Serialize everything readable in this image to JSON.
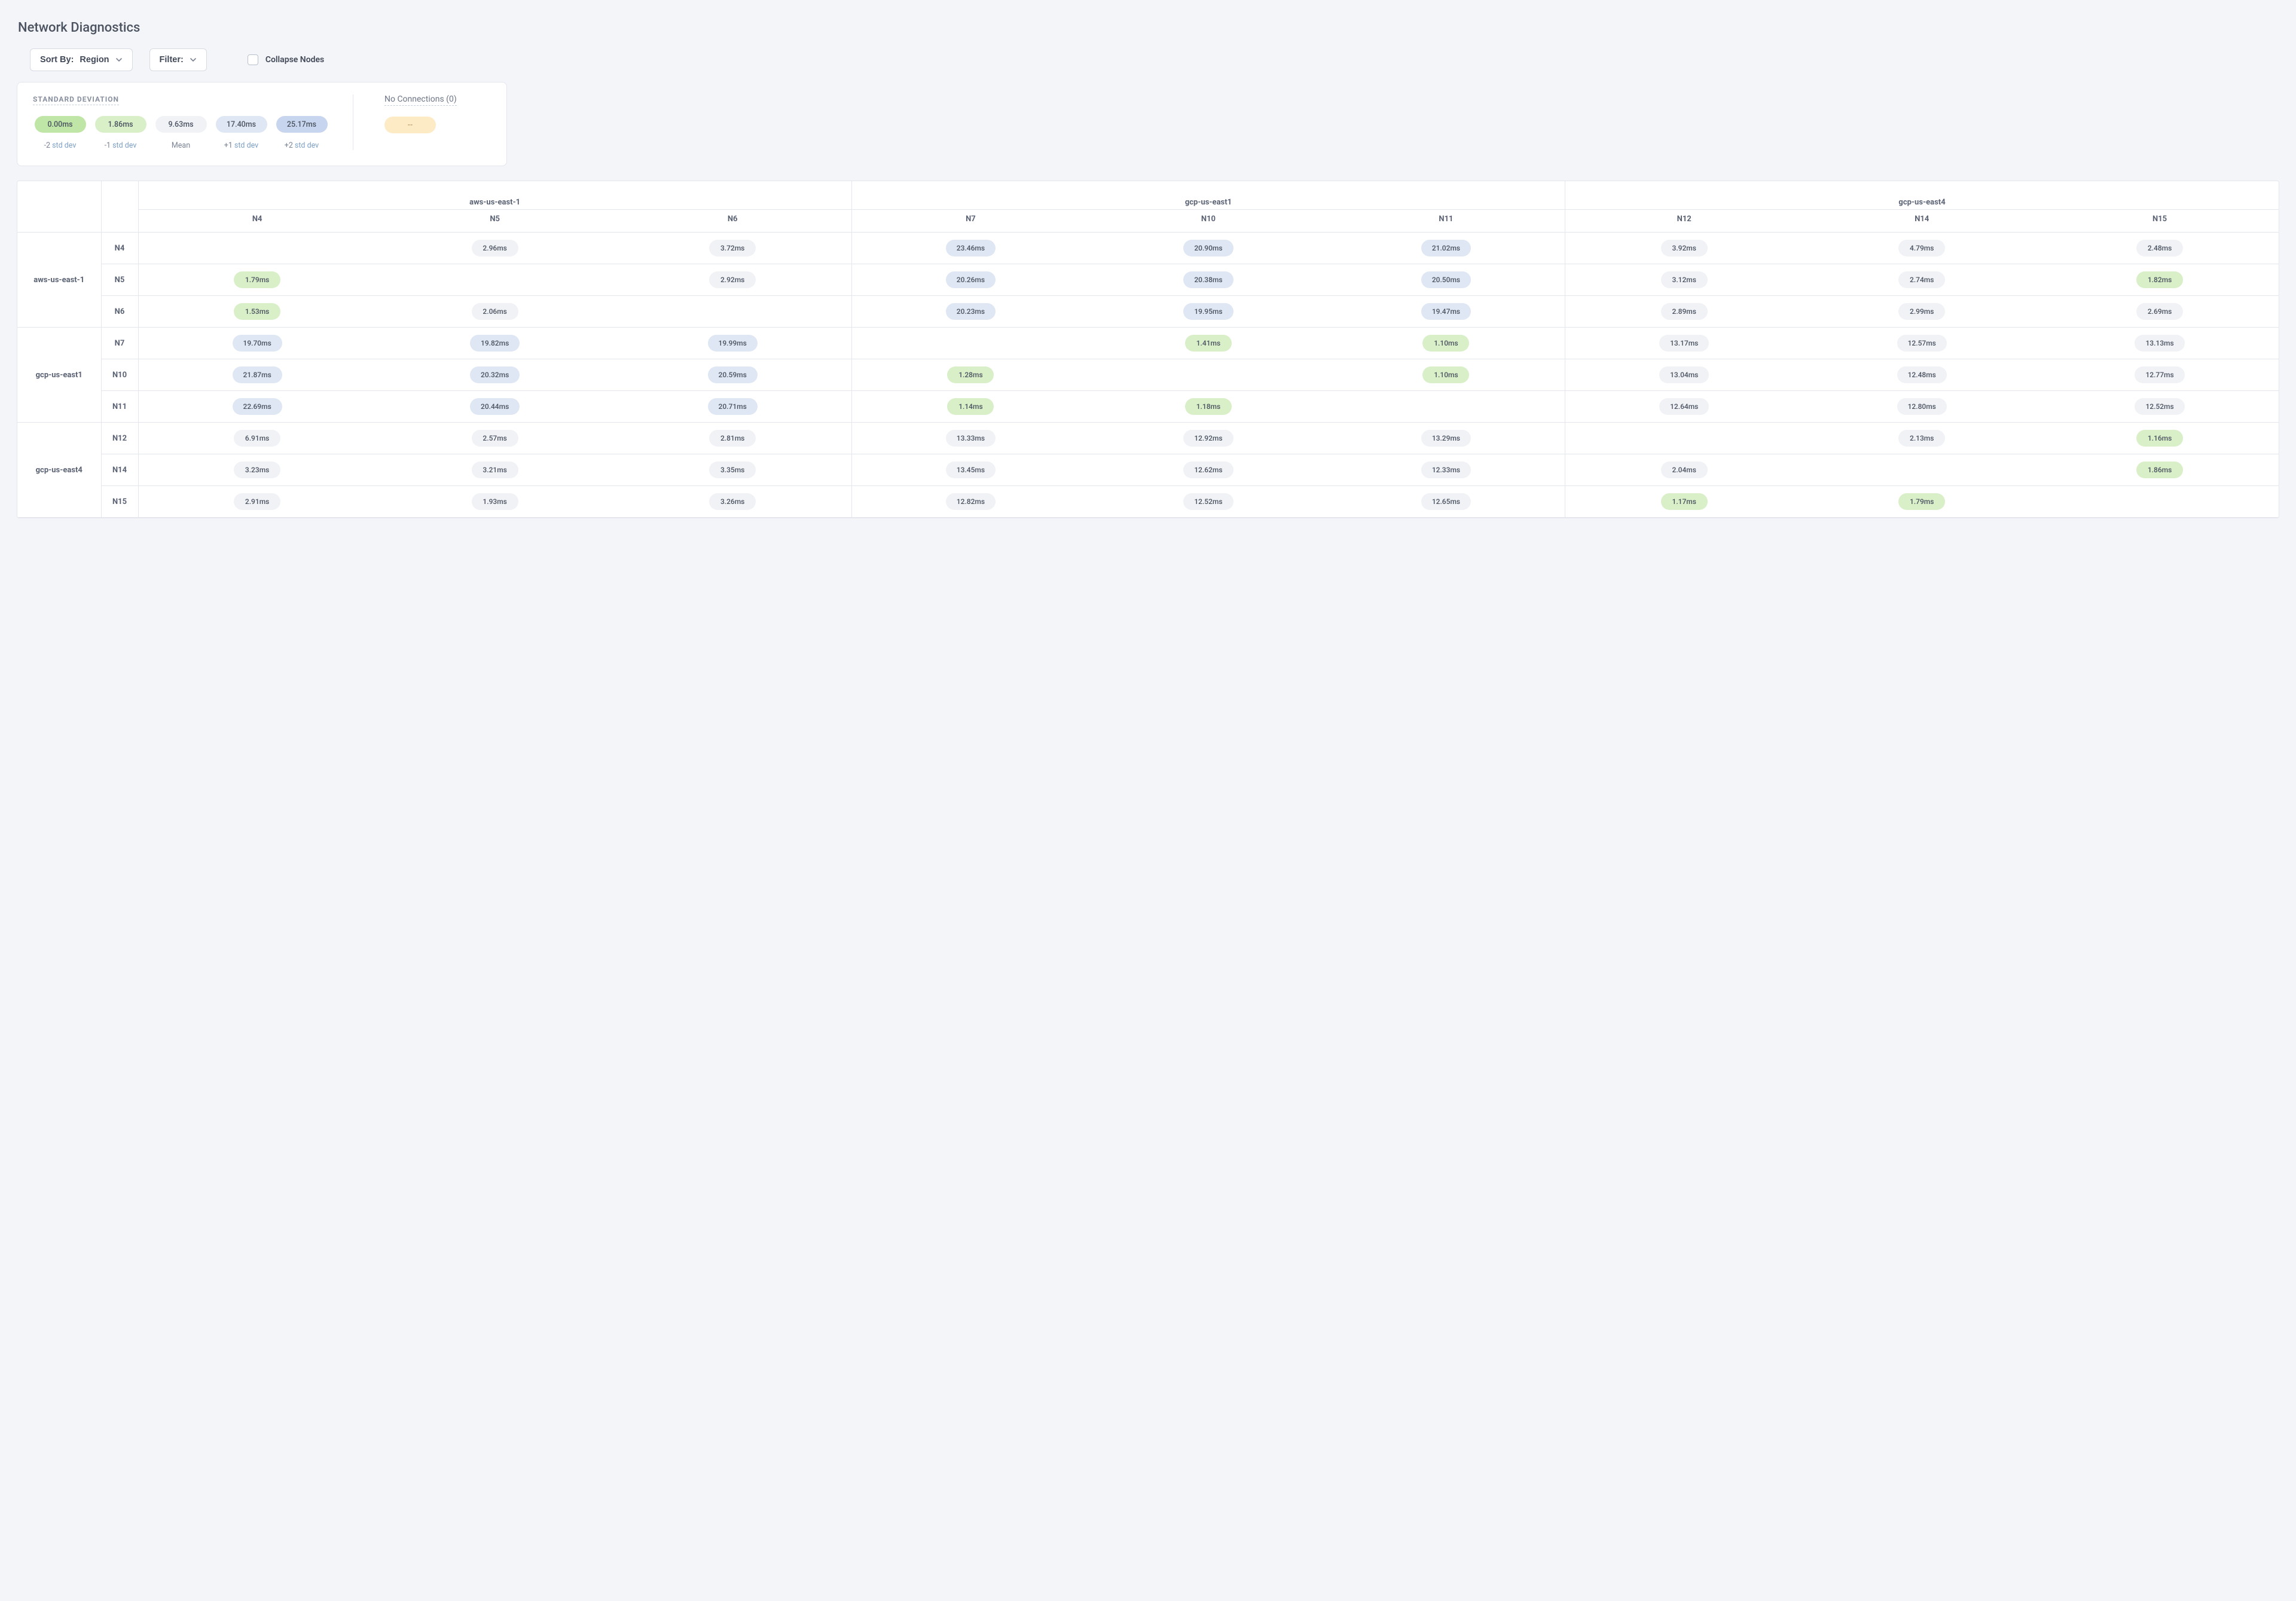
{
  "title": "Network Diagnostics",
  "controls": {
    "sort_by": {
      "label": "Sort By:",
      "value": "Region"
    },
    "filter": {
      "label": "Filter:"
    },
    "collapse": {
      "label": "Collapse Nodes",
      "checked": false
    }
  },
  "legend": {
    "heading": "STANDARD DEVIATION",
    "levels": [
      {
        "value": "0.00ms",
        "caption_prefix": "-2",
        "caption_link": "std dev",
        "class": "green-strong"
      },
      {
        "value": "1.86ms",
        "caption_prefix": "-1",
        "caption_link": "std dev",
        "class": "green-light"
      },
      {
        "value": "9.63ms",
        "caption_prefix": "Mean",
        "caption_link": "",
        "class": ""
      },
      {
        "value": "17.40ms",
        "caption_prefix": "+1",
        "caption_link": "std dev",
        "class": "blue-light"
      },
      {
        "value": "25.17ms",
        "caption_prefix": "+2",
        "caption_link": "std dev",
        "class": "blue-strong"
      }
    ],
    "no_connections_label": "No Connections (0)",
    "no_connections_value": "--"
  },
  "matrix": {
    "region_groups": [
      {
        "name": "aws-us-east-1",
        "nodes": [
          "N4",
          "N5",
          "N6"
        ]
      },
      {
        "name": "gcp-us-east1",
        "nodes": [
          "N7",
          "N10",
          "N11"
        ]
      },
      {
        "name": "gcp-us-east4",
        "nodes": [
          "N12",
          "N14",
          "N15"
        ]
      }
    ],
    "row_groups": [
      {
        "name": "aws-us-east-1",
        "rows": [
          {
            "node": "N4",
            "cells": [
              {
                "v": ""
              },
              {
                "v": "2.96ms",
                "c": ""
              },
              {
                "v": "3.72ms",
                "c": ""
              },
              {
                "v": "23.46ms",
                "c": "blue-light"
              },
              {
                "v": "20.90ms",
                "c": "blue-light"
              },
              {
                "v": "21.02ms",
                "c": "blue-light"
              },
              {
                "v": "3.92ms",
                "c": ""
              },
              {
                "v": "4.79ms",
                "c": ""
              },
              {
                "v": "2.48ms",
                "c": ""
              }
            ]
          },
          {
            "node": "N5",
            "cells": [
              {
                "v": "1.79ms",
                "c": "green-light"
              },
              {
                "v": ""
              },
              {
                "v": "2.92ms",
                "c": ""
              },
              {
                "v": "20.26ms",
                "c": "blue-light"
              },
              {
                "v": "20.38ms",
                "c": "blue-light"
              },
              {
                "v": "20.50ms",
                "c": "blue-light"
              },
              {
                "v": "3.12ms",
                "c": ""
              },
              {
                "v": "2.74ms",
                "c": ""
              },
              {
                "v": "1.82ms",
                "c": "green-light"
              }
            ]
          },
          {
            "node": "N6",
            "cells": [
              {
                "v": "1.53ms",
                "c": "green-light"
              },
              {
                "v": "2.06ms",
                "c": ""
              },
              {
                "v": ""
              },
              {
                "v": "20.23ms",
                "c": "blue-light"
              },
              {
                "v": "19.95ms",
                "c": "blue-light"
              },
              {
                "v": "19.47ms",
                "c": "blue-light"
              },
              {
                "v": "2.89ms",
                "c": ""
              },
              {
                "v": "2.99ms",
                "c": ""
              },
              {
                "v": "2.69ms",
                "c": ""
              }
            ]
          }
        ]
      },
      {
        "name": "gcp-us-east1",
        "rows": [
          {
            "node": "N7",
            "cells": [
              {
                "v": "19.70ms",
                "c": "blue-light"
              },
              {
                "v": "19.82ms",
                "c": "blue-light"
              },
              {
                "v": "19.99ms",
                "c": "blue-light"
              },
              {
                "v": ""
              },
              {
                "v": "1.41ms",
                "c": "green-light"
              },
              {
                "v": "1.10ms",
                "c": "green-light"
              },
              {
                "v": "13.17ms",
                "c": ""
              },
              {
                "v": "12.57ms",
                "c": ""
              },
              {
                "v": "13.13ms",
                "c": ""
              }
            ]
          },
          {
            "node": "N10",
            "cells": [
              {
                "v": "21.87ms",
                "c": "blue-light"
              },
              {
                "v": "20.32ms",
                "c": "blue-light"
              },
              {
                "v": "20.59ms",
                "c": "blue-light"
              },
              {
                "v": "1.28ms",
                "c": "green-light"
              },
              {
                "v": ""
              },
              {
                "v": "1.10ms",
                "c": "green-light"
              },
              {
                "v": "13.04ms",
                "c": ""
              },
              {
                "v": "12.48ms",
                "c": ""
              },
              {
                "v": "12.77ms",
                "c": ""
              }
            ]
          },
          {
            "node": "N11",
            "cells": [
              {
                "v": "22.69ms",
                "c": "blue-light"
              },
              {
                "v": "20.44ms",
                "c": "blue-light"
              },
              {
                "v": "20.71ms",
                "c": "blue-light"
              },
              {
                "v": "1.14ms",
                "c": "green-light"
              },
              {
                "v": "1.18ms",
                "c": "green-light"
              },
              {
                "v": ""
              },
              {
                "v": "12.64ms",
                "c": ""
              },
              {
                "v": "12.80ms",
                "c": ""
              },
              {
                "v": "12.52ms",
                "c": ""
              }
            ]
          }
        ]
      },
      {
        "name": "gcp-us-east4",
        "rows": [
          {
            "node": "N12",
            "cells": [
              {
                "v": "6.91ms",
                "c": ""
              },
              {
                "v": "2.57ms",
                "c": ""
              },
              {
                "v": "2.81ms",
                "c": ""
              },
              {
                "v": "13.33ms",
                "c": ""
              },
              {
                "v": "12.92ms",
                "c": ""
              },
              {
                "v": "13.29ms",
                "c": ""
              },
              {
                "v": ""
              },
              {
                "v": "2.13ms",
                "c": ""
              },
              {
                "v": "1.16ms",
                "c": "green-light"
              }
            ]
          },
          {
            "node": "N14",
            "cells": [
              {
                "v": "3.23ms",
                "c": ""
              },
              {
                "v": "3.21ms",
                "c": ""
              },
              {
                "v": "3.35ms",
                "c": ""
              },
              {
                "v": "13.45ms",
                "c": ""
              },
              {
                "v": "12.62ms",
                "c": ""
              },
              {
                "v": "12.33ms",
                "c": ""
              },
              {
                "v": "2.04ms",
                "c": ""
              },
              {
                "v": ""
              },
              {
                "v": "1.86ms",
                "c": "green-light"
              }
            ]
          },
          {
            "node": "N15",
            "cells": [
              {
                "v": "2.91ms",
                "c": ""
              },
              {
                "v": "1.93ms",
                "c": ""
              },
              {
                "v": "3.26ms",
                "c": ""
              },
              {
                "v": "12.82ms",
                "c": ""
              },
              {
                "v": "12.52ms",
                "c": ""
              },
              {
                "v": "12.65ms",
                "c": ""
              },
              {
                "v": "1.17ms",
                "c": "green-light"
              },
              {
                "v": "1.79ms",
                "c": "green-light"
              },
              {
                "v": ""
              }
            ]
          }
        ]
      }
    ]
  }
}
